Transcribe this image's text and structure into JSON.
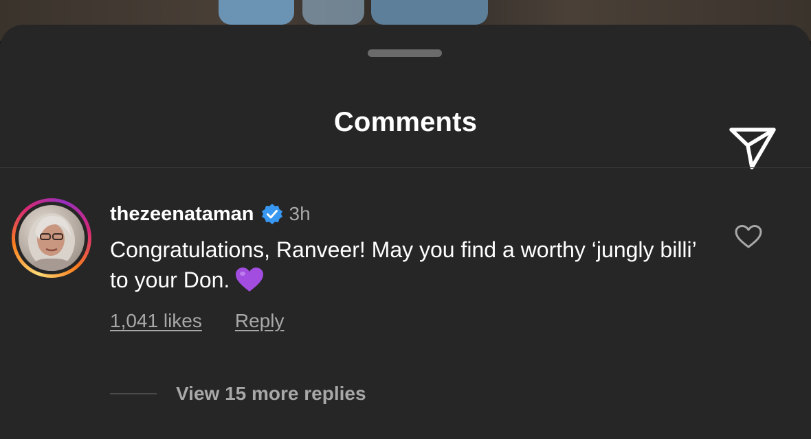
{
  "header": {
    "title": "Comments",
    "share_icon": "paper-plane-icon"
  },
  "comment": {
    "username": "thezeenataman",
    "verified_icon": "verified-badge-icon",
    "time": "3h",
    "text": "Congratulations, Ranveer! May you find a worthy ‘jungly billi’ to your Don.",
    "emoji": "purple-heart-icon",
    "likes_label": "1,041 likes",
    "reply_label": "Reply",
    "like_icon": "heart-outline-icon",
    "avatar_ring_colors": [
      "#feda75",
      "#fa7e1e",
      "#d62976",
      "#962fbf"
    ]
  },
  "replies": {
    "view_more_label": "View 15 more replies"
  },
  "colors": {
    "sheet_bg": "#262626",
    "primary_text": "#ffffff",
    "secondary_text": "#a8a8a8",
    "verified_blue": "#3897f0",
    "emoji_purple": "#a24de0"
  }
}
